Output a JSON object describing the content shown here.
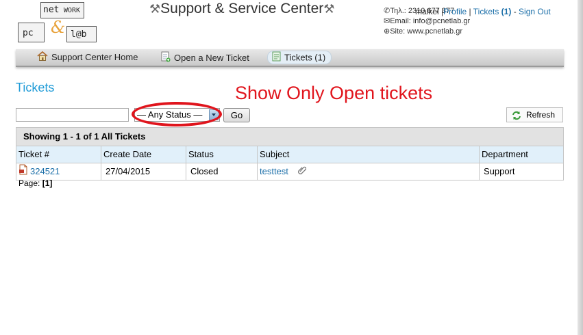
{
  "header": {
    "logo": {
      "word1": "net",
      "word1b": "WORK",
      "word2": "pc",
      "amp": "&",
      "word3": "l@b"
    },
    "title": "Support & Service Center",
    "contact": {
      "phone": "Τηλ.: 2310 677 377",
      "email": "Email: info@pcnetlab.gr",
      "site": "Site: www.pcnetlab.gr"
    },
    "user": {
      "name": "malkel",
      "profile": "Profile",
      "tickets": "Tickets",
      "tickets_count": "(1)",
      "sign_out": "Sign Out"
    }
  },
  "nav": {
    "items": [
      {
        "label": "Support Center Home",
        "icon": "home-icon"
      },
      {
        "label": "Open a New Ticket",
        "icon": "new-ticket-icon"
      },
      {
        "label": "Tickets (1)",
        "icon": "tickets-icon",
        "active": true
      }
    ]
  },
  "page": {
    "heading": "Tickets",
    "annotation": "Show Only Open tickets"
  },
  "filter": {
    "search_value": "",
    "status_selected": "— Any Status —",
    "go_label": "Go",
    "refresh_label": "Refresh"
  },
  "table": {
    "caption": "Showing  1 - 1 of 1 All Tickets",
    "columns": [
      "Ticket #",
      "Create Date",
      "Status",
      "Subject",
      "Department"
    ],
    "rows": [
      {
        "ticket": "324521",
        "date": "27/04/2015",
        "status": "Closed",
        "subject": "testtest",
        "department": "Support"
      }
    ]
  },
  "pager": {
    "label": "Page:",
    "current": "[1]"
  },
  "colors": {
    "link": "#1a6ea8",
    "heading": "#1f9bd7",
    "annotation": "#e1151d",
    "table_header": "#e1f0fa"
  }
}
